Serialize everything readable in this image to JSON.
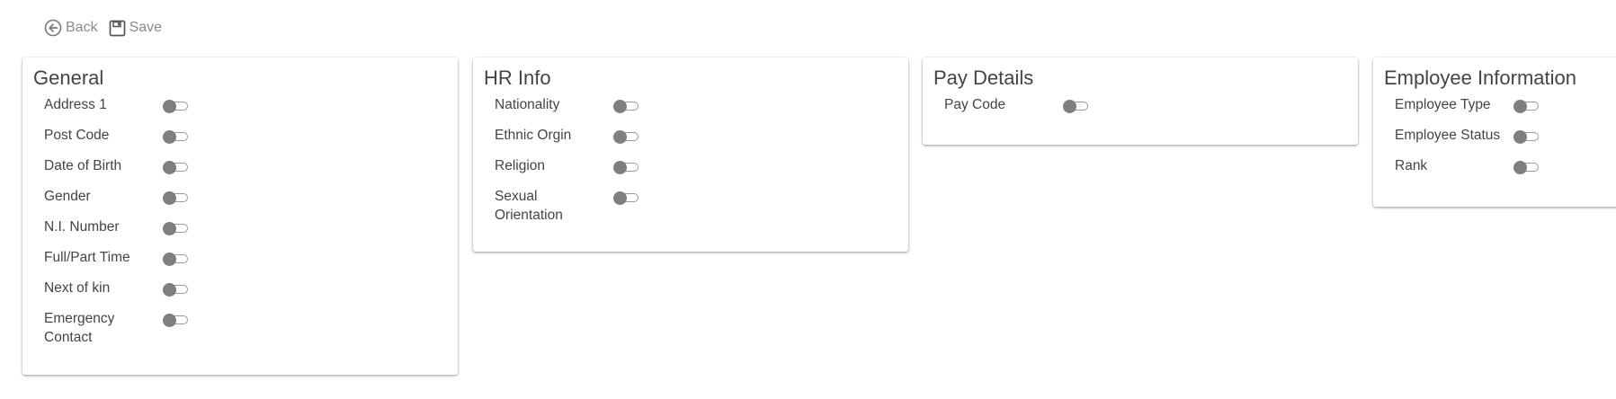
{
  "toolbar": {
    "back_label": "Back",
    "save_label": "Save",
    "back_icon": "back-arrow-circle-icon",
    "save_icon": "floppy-disk-icon"
  },
  "colors": {
    "toggle_knob": "#7f7f7f",
    "toggle_track": "#9a9a9a",
    "text": "#444444",
    "toolbar_text": "#8a8a8a"
  },
  "cards": [
    {
      "title": "General",
      "fields": [
        {
          "label": "Address 1",
          "enabled": false
        },
        {
          "label": "Post Code",
          "enabled": false
        },
        {
          "label": "Date of Birth",
          "enabled": false
        },
        {
          "label": "Gender",
          "enabled": false
        },
        {
          "label": "N.I. Number",
          "enabled": false
        },
        {
          "label": "Full/Part Time",
          "enabled": false
        },
        {
          "label": "Next of kin",
          "enabled": false
        },
        {
          "label": "Emergency Contact",
          "enabled": false
        }
      ]
    },
    {
      "title": "HR Info",
      "fields": [
        {
          "label": "Nationality",
          "enabled": false
        },
        {
          "label": "Ethnic Orgin",
          "enabled": false
        },
        {
          "label": "Religion",
          "enabled": false
        },
        {
          "label": "Sexual Orientation",
          "enabled": false
        }
      ]
    },
    {
      "title": "Pay Details",
      "fields": [
        {
          "label": "Pay Code",
          "enabled": false
        }
      ]
    },
    {
      "title": "Employee Information",
      "fields": [
        {
          "label": "Employee Type",
          "enabled": false
        },
        {
          "label": "Employee Status",
          "enabled": false
        },
        {
          "label": "Rank",
          "enabled": false
        }
      ]
    }
  ]
}
